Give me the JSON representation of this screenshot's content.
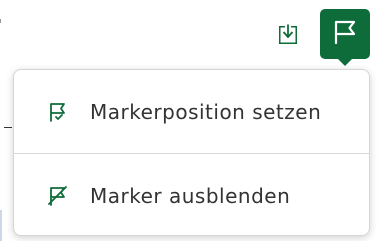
{
  "toolbar": {
    "download_icon": "download-icon",
    "marker_icon": "flag-icon",
    "accent_color": "#0e6b3a"
  },
  "menu": {
    "items": [
      {
        "label": "Markerposition setzen",
        "icon": "flag-check-icon"
      },
      {
        "label": "Marker ausblenden",
        "icon": "flag-off-icon"
      }
    ]
  }
}
